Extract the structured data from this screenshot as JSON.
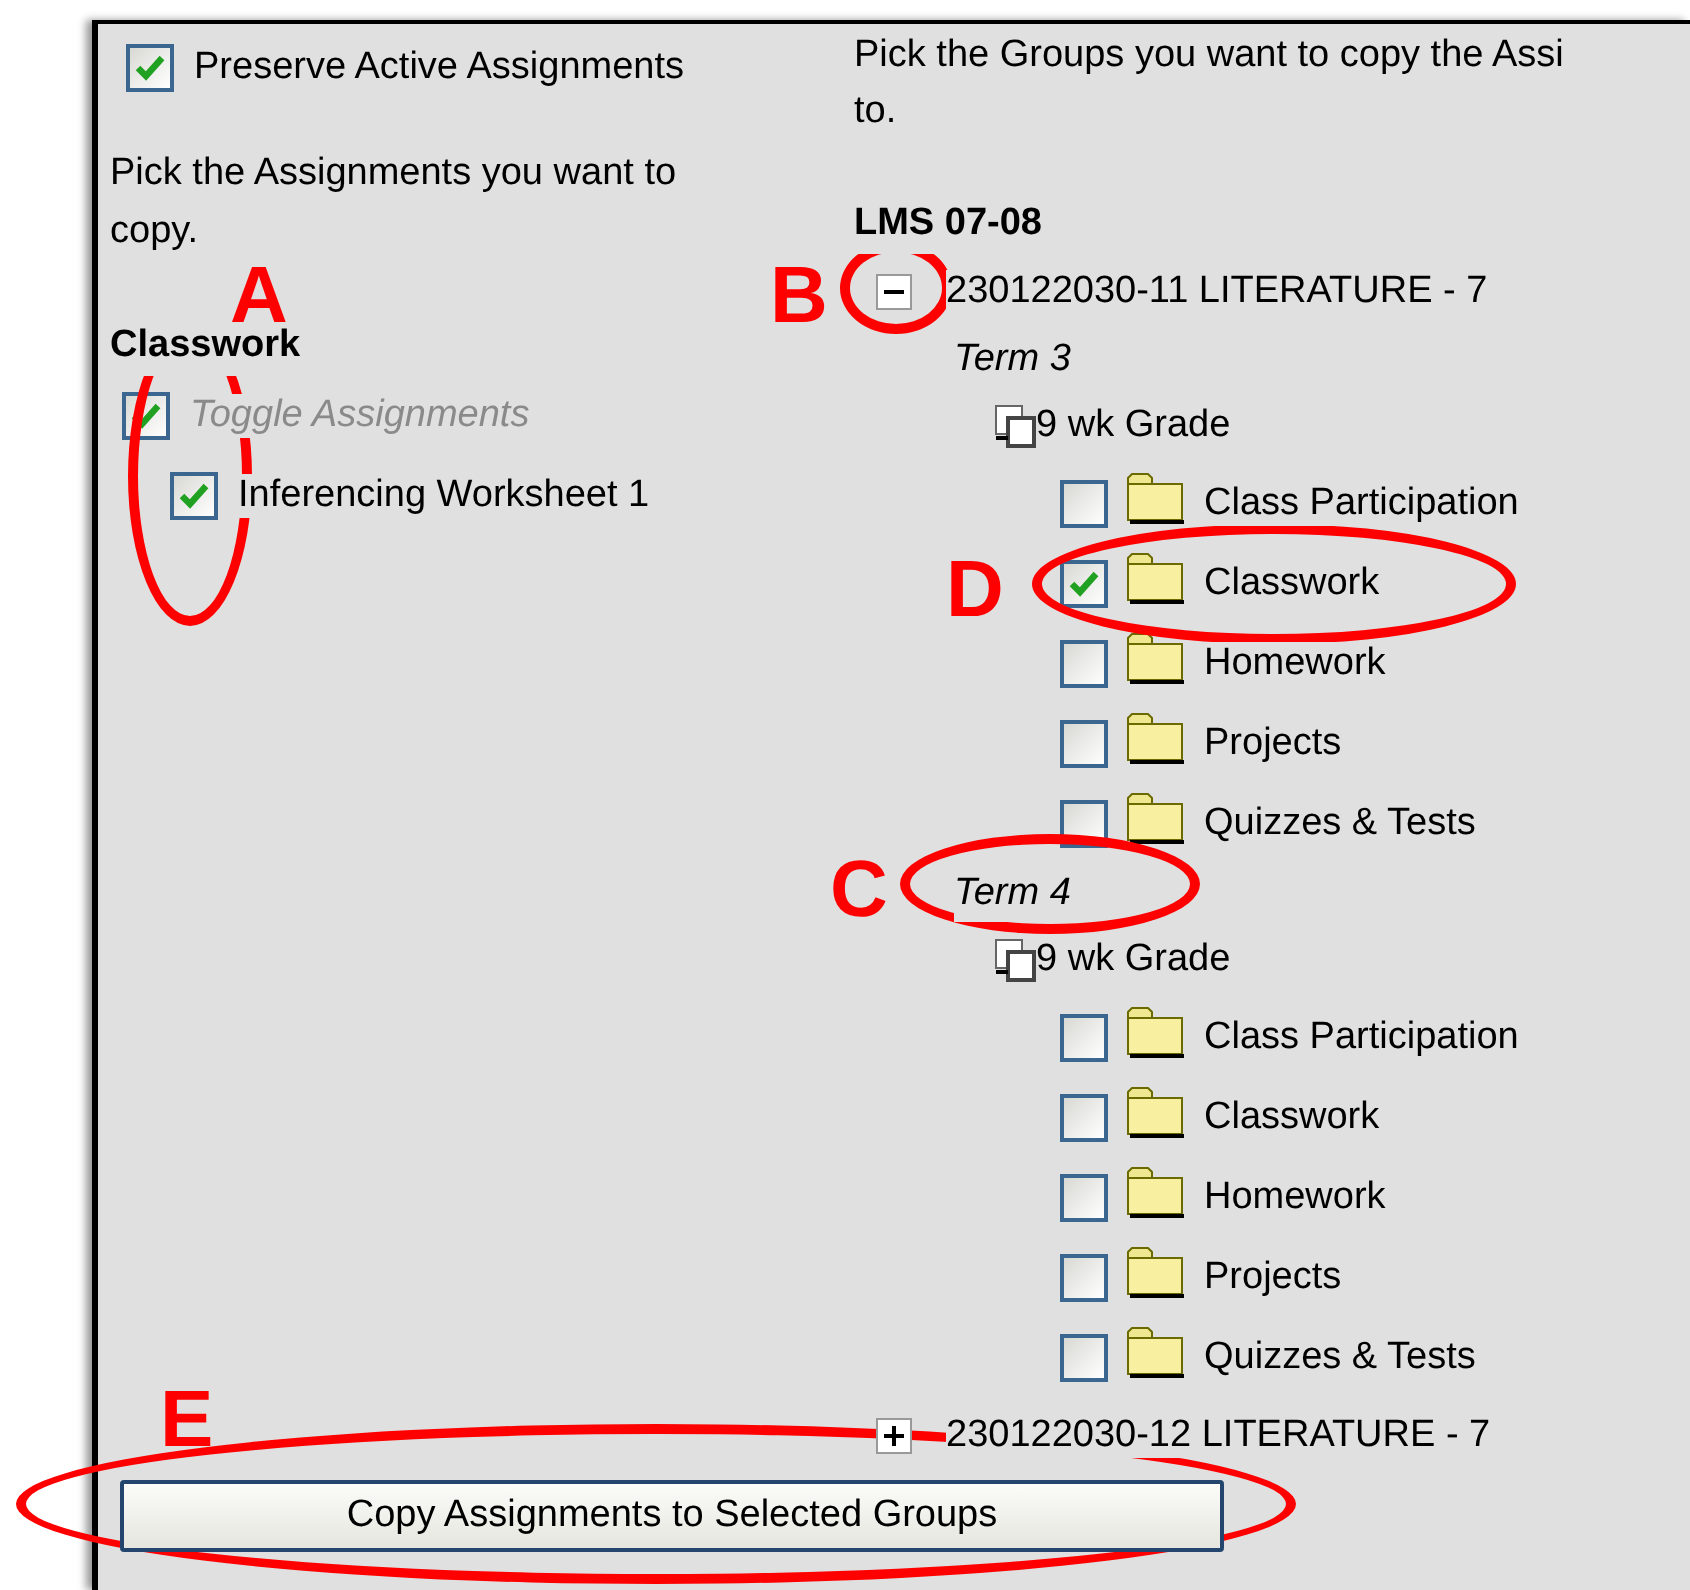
{
  "preserve": {
    "label": "Preserve Active Assignments",
    "checked": true
  },
  "left": {
    "instructions": "Pick the Assignments you want to copy.",
    "category": "Classwork",
    "toggle": {
      "label": "Toggle Assignments",
      "checked": true
    },
    "assignments": [
      {
        "label": "Inferencing Worksheet 1",
        "checked": true
      }
    ]
  },
  "right": {
    "instruction_lines": [
      "Pick the Groups you want to copy the Assi",
      "to."
    ],
    "school": "LMS 07-08",
    "groups": [
      {
        "name": "230122030-11 LITERATURE - 7",
        "expanded": true,
        "terms": [
          {
            "name": "Term 3",
            "tasks": [
              {
                "name": "9 wk Grade",
                "categories": [
                  {
                    "name": "Class Participation",
                    "checked": false
                  },
                  {
                    "name": "Classwork",
                    "checked": true
                  },
                  {
                    "name": "Homework",
                    "checked": false
                  },
                  {
                    "name": "Projects",
                    "checked": false
                  },
                  {
                    "name": "Quizzes & Tests",
                    "checked": false
                  }
                ]
              }
            ]
          },
          {
            "name": "Term 4",
            "tasks": [
              {
                "name": "9 wk Grade",
                "categories": [
                  {
                    "name": "Class Participation",
                    "checked": false
                  },
                  {
                    "name": "Classwork",
                    "checked": false
                  },
                  {
                    "name": "Homework",
                    "checked": false
                  },
                  {
                    "name": "Projects",
                    "checked": false
                  },
                  {
                    "name": "Quizzes & Tests",
                    "checked": false
                  }
                ]
              }
            ]
          }
        ]
      },
      {
        "name": "230122030-12 LITERATURE - 7",
        "expanded": false
      }
    ]
  },
  "button": "Copy Assignments to Selected Groups",
  "annotations": [
    {
      "label": "A"
    },
    {
      "label": "B"
    },
    {
      "label": "C"
    },
    {
      "label": "D"
    },
    {
      "label": "E"
    }
  ]
}
